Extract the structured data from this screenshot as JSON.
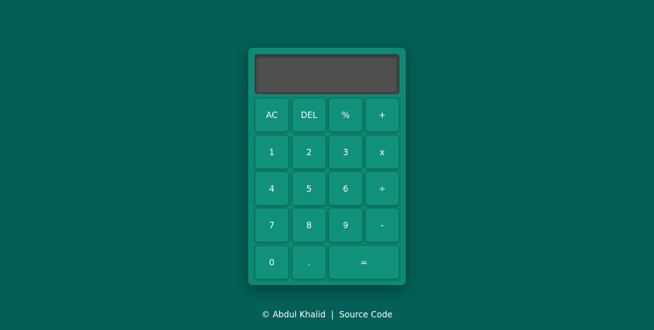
{
  "calculator": {
    "display_value": "",
    "keys": {
      "ac": "AC",
      "del": "DEL",
      "percent": "%",
      "add": "+",
      "one": "1",
      "two": "2",
      "three": "3",
      "multiply": "x",
      "four": "4",
      "five": "5",
      "six": "6",
      "divide": "÷",
      "seven": "7",
      "eight": "8",
      "nine": "9",
      "subtract": "-",
      "zero": "0",
      "dot": ".",
      "equals": "="
    }
  },
  "footer": {
    "copyright": "© Abdul Khalid",
    "separator": "|",
    "source_link": "Source Code"
  },
  "colors": {
    "background": "#035f57",
    "calculator_body": "#0e8a74",
    "key": "#11917b",
    "display": "#4f4f4f"
  }
}
